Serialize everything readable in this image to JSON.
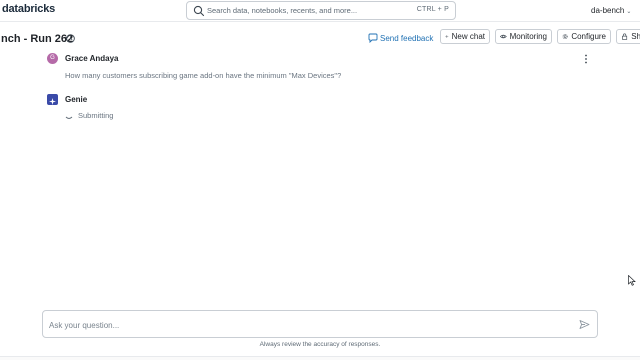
{
  "app": {
    "logo_text": "databricks",
    "workspace": "da-bench"
  },
  "search": {
    "placeholder": "Search data, notebooks, recents, and more...",
    "shortcut": "CTRL + P"
  },
  "titlebar": {
    "title": "nch - Run 262",
    "send_feedback": "Send feedback",
    "new_chat": "New chat",
    "monitoring": "Monitoring",
    "configure": "Configure",
    "share": "Sh"
  },
  "messages": [
    {
      "sender": "Grace Andaya",
      "avatar_initial": "G",
      "text": "How many customers subscribing game add-on have the minimum \"Max Devices\"?"
    },
    {
      "sender": "Genie",
      "status": "Submitting"
    }
  ],
  "input": {
    "placeholder": "Ask your question..."
  },
  "disclaimer": "Always review the accuracy of responses.",
  "colors": {
    "accent": "#2272b4",
    "user_avatar": "#b56aa8",
    "genie_avatar": "#3a4aa8"
  }
}
